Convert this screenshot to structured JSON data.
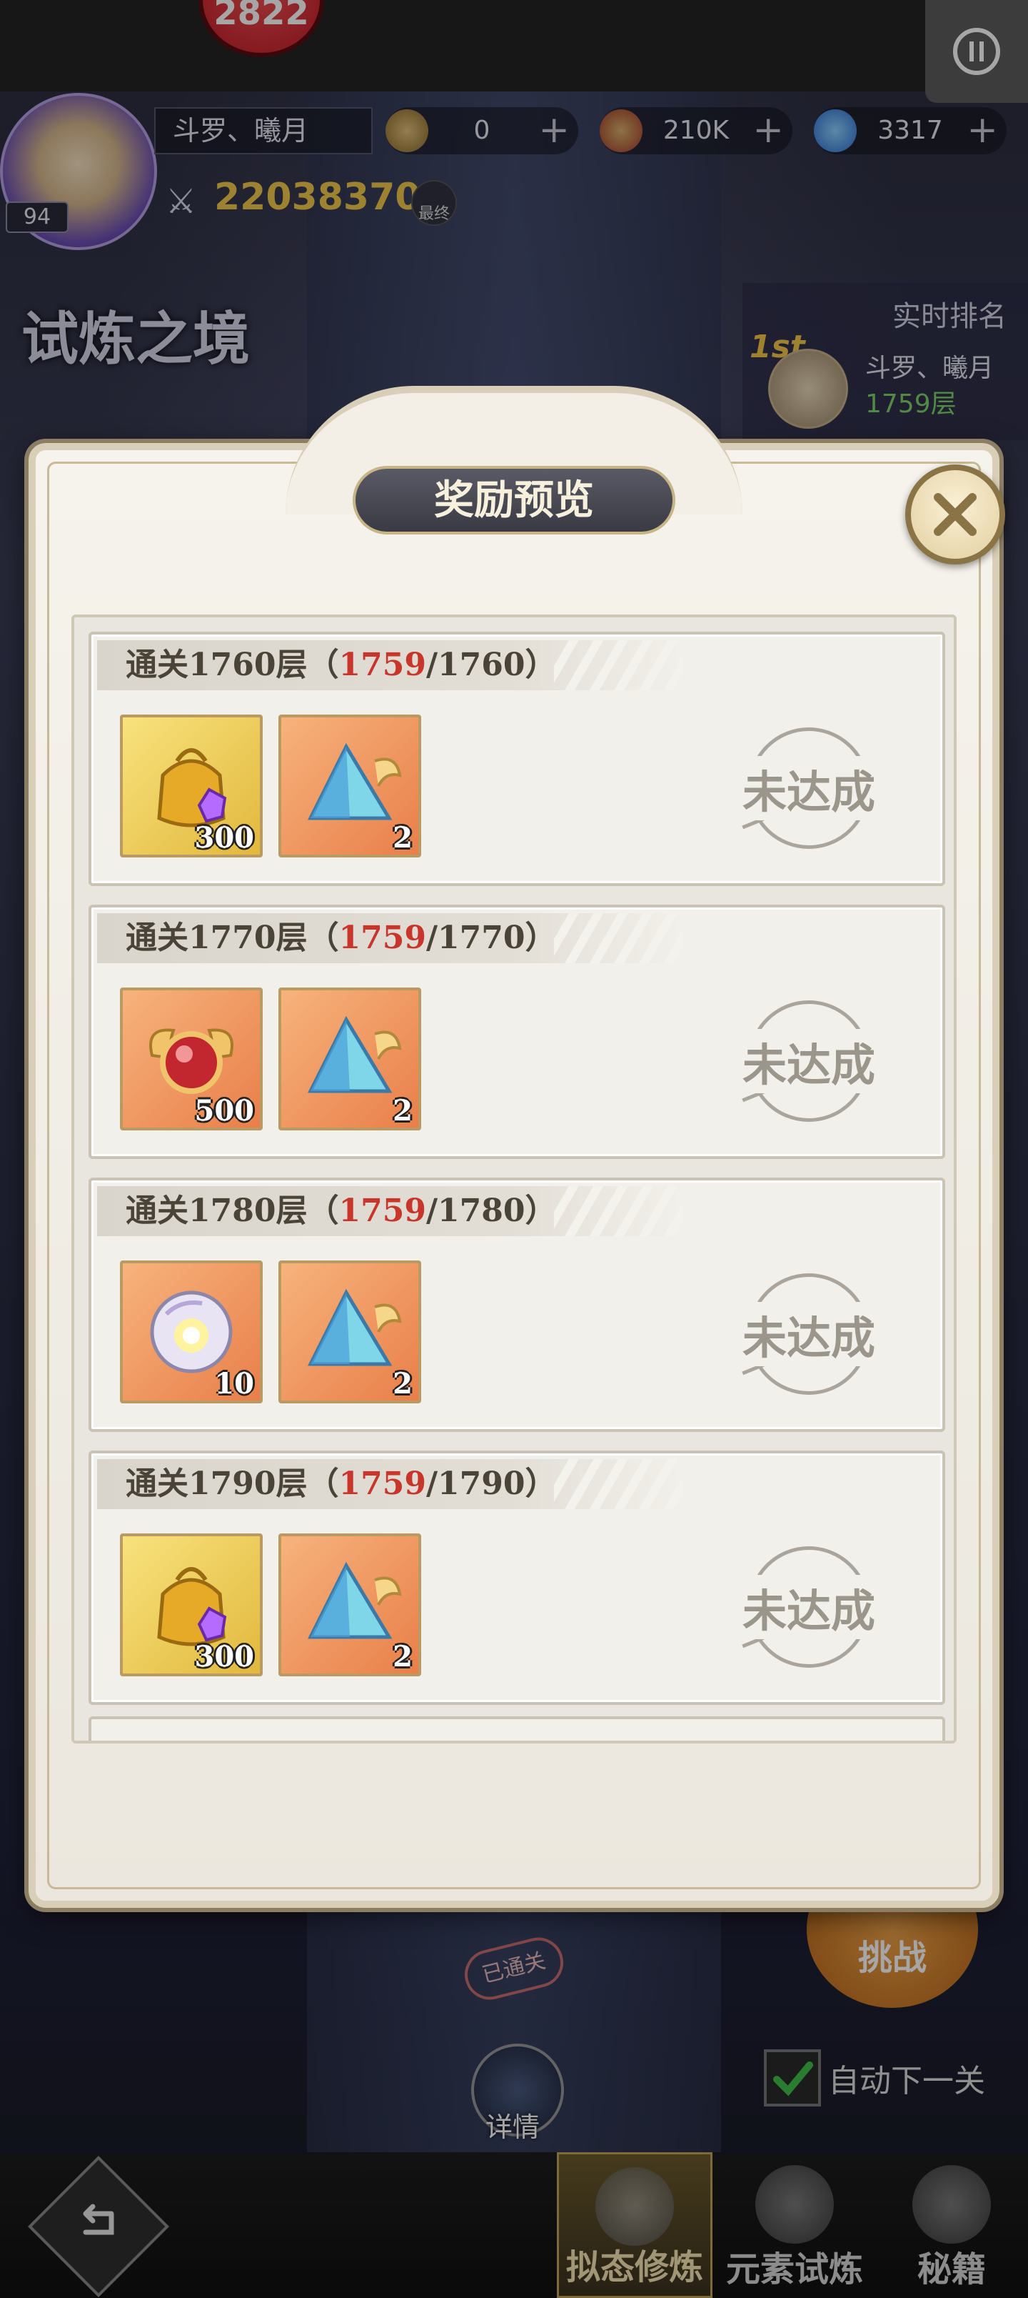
{
  "top": {
    "badge_text": "2822",
    "player_name": "斗罗、曦月",
    "player_level": "94",
    "power": "22038370",
    "final_label": "最终",
    "resources": [
      {
        "icon": "coin-icon",
        "value": "0"
      },
      {
        "icon": "compass-gem-icon",
        "value": "210K"
      },
      {
        "icon": "diamond-icon",
        "value": "3317"
      }
    ]
  },
  "mode": {
    "title": "试炼之境",
    "ranking_label": "实时排名",
    "rank_place": "1st",
    "rank_name": "斗罗、曦月",
    "rank_floor": "1759层"
  },
  "modal": {
    "title": "奖励预览",
    "rows": [
      {
        "label": "通关1760层（",
        "current": "1759",
        "target": "/1760）",
        "status": "未达成",
        "items": [
          {
            "icon": "gold-bag-icon",
            "count": "300"
          },
          {
            "icon": "winged-crystal-icon",
            "count": "2"
          }
        ]
      },
      {
        "label": "通关1770层（",
        "current": "1759",
        "target": "/1770）",
        "status": "未达成",
        "items": [
          {
            "icon": "red-orb-icon",
            "count": "500"
          },
          {
            "icon": "winged-crystal-icon",
            "count": "2"
          }
        ]
      },
      {
        "label": "通关1780层（",
        "current": "1759",
        "target": "/1780）",
        "status": "未达成",
        "items": [
          {
            "icon": "light-sphere-icon",
            "count": "10"
          },
          {
            "icon": "winged-crystal-icon",
            "count": "2"
          }
        ]
      },
      {
        "label": "通关1790层（",
        "current": "1759",
        "target": "/1790）",
        "status": "未达成",
        "items": [
          {
            "icon": "gold-bag-icon",
            "count": "300"
          },
          {
            "icon": "winged-crystal-icon",
            "count": "2"
          }
        ]
      }
    ]
  },
  "bottom": {
    "challenge_label": "挑战",
    "cleared_label": "已通关",
    "auto_next_label": "自动下一关",
    "details_label": "详情",
    "nav": [
      {
        "label": "拟态修炼",
        "active": true
      },
      {
        "label": "元素试炼",
        "active": false
      },
      {
        "label": "秘籍",
        "active": false
      }
    ]
  },
  "colors": {
    "accent_red": "#c8352b",
    "gold": "#f2c94c",
    "floor_green": "#7ed46a"
  }
}
